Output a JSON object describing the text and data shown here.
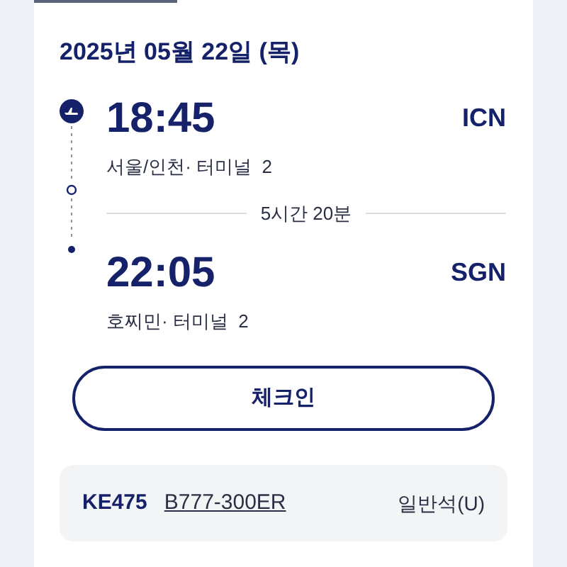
{
  "date": "2025년 05월 22일 (목)",
  "departure": {
    "time": "18:45",
    "code": "ICN",
    "place": "서울/인천· 터미널  2"
  },
  "duration": "5시간 20분",
  "arrival": {
    "time": "22:05",
    "code": "SGN",
    "place": "호찌민· 터미널  2"
  },
  "checkin_button": "체크인",
  "flight": {
    "number": "KE475",
    "aircraft": "B777-300ER",
    "cabin": "일반석(U)"
  }
}
